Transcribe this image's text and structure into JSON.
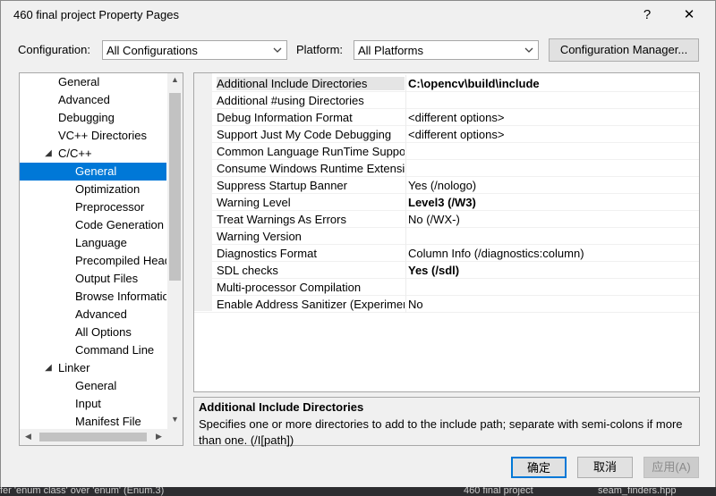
{
  "window": {
    "title": "460 final project Property Pages",
    "help_icon": "?",
    "close_icon": "✕"
  },
  "config": {
    "configuration_label": "Configuration:",
    "configuration_value": "All Configurations",
    "platform_label": "Platform:",
    "platform_value": "All Platforms",
    "manager_button": "Configuration Manager..."
  },
  "tree": {
    "items": [
      {
        "label": "General"
      },
      {
        "label": "Advanced"
      },
      {
        "label": "Debugging"
      },
      {
        "label": "VC++ Directories"
      },
      {
        "label": "C/C++"
      },
      {
        "label": "General"
      },
      {
        "label": "Optimization"
      },
      {
        "label": "Preprocessor"
      },
      {
        "label": "Code Generation"
      },
      {
        "label": "Language"
      },
      {
        "label": "Precompiled Headers"
      },
      {
        "label": "Output Files"
      },
      {
        "label": "Browse Information"
      },
      {
        "label": "Advanced"
      },
      {
        "label": "All Options"
      },
      {
        "label": "Command Line"
      },
      {
        "label": "Linker"
      },
      {
        "label": "General"
      },
      {
        "label": "Input"
      },
      {
        "label": "Manifest File"
      }
    ]
  },
  "grid": {
    "rows": [
      {
        "name": "Additional Include Directories",
        "value": "C:\\opencv\\build\\include"
      },
      {
        "name": "Additional #using Directories",
        "value": ""
      },
      {
        "name": "Debug Information Format",
        "value": "<different options>"
      },
      {
        "name": "Support Just My Code Debugging",
        "value": "<different options>"
      },
      {
        "name": "Common Language RunTime Support",
        "value": ""
      },
      {
        "name": "Consume Windows Runtime Extension",
        "value": ""
      },
      {
        "name": "Suppress Startup Banner",
        "value": "Yes (/nologo)"
      },
      {
        "name": "Warning Level",
        "value": "Level3 (/W3)"
      },
      {
        "name": "Treat Warnings As Errors",
        "value": "No (/WX-)"
      },
      {
        "name": "Warning Version",
        "value": ""
      },
      {
        "name": "Diagnostics Format",
        "value": "Column Info (/diagnostics:column)"
      },
      {
        "name": "SDL checks",
        "value": "Yes (/sdl)"
      },
      {
        "name": "Multi-processor Compilation",
        "value": ""
      },
      {
        "name": "Enable Address Sanitizer (Experimental)",
        "value": "No"
      }
    ]
  },
  "description": {
    "title": "Additional Include Directories",
    "text": "Specifies one or more directories to add to the include path; separate with semi-colons if more than one.     (/I[path])"
  },
  "buttons": {
    "ok": "确定",
    "cancel": "取消",
    "apply": "应用(A)"
  },
  "background": {
    "text1": "fer 'enum class' over 'enum' (Enum.3)",
    "text2": "460 final project",
    "text3": "seam_finders.hpp"
  },
  "colors": {
    "selection": "#0078d7",
    "dialog_bg": "#f0f0f0"
  }
}
